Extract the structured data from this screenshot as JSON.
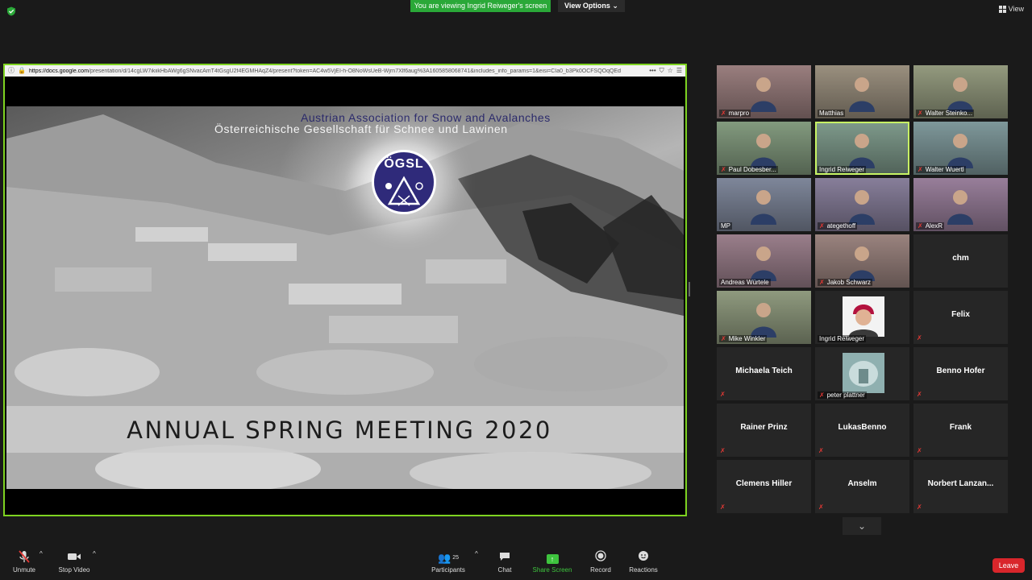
{
  "banner": {
    "viewing_text": "You are viewing Ingrid Reiweger's screen",
    "view_options_label": "View Options ⌄"
  },
  "top_right": {
    "view_label": "View"
  },
  "browser": {
    "url_host": "https://docs.google.com",
    "url_path": "/presentation/d/14cgLW7ikiikHbAWg6gSNvacAmT4tGsgU2f4EGMHAqZ4/present?token=AC4w5VjEI-h-O8NoWsUeB-Wjrn7Xlf6aug%3A1605858068741&includes_info_params=1&eisi=CIa0_b3Pk0OCFSQOqQEd"
  },
  "slide": {
    "subtitle_en": "Austrian Association for Snow and Avalanches",
    "subtitle_de": "Österreichische Gesellschaft für Schnee und Lawinen",
    "logo_text": "ÖGSL",
    "logo_sub": "ÖGSL",
    "title": "ANNUAL SPRING MEETING 2020"
  },
  "participants_gallery": [
    {
      "name": "marpro",
      "video": true,
      "muted": true
    },
    {
      "name": "Matthias",
      "video": true,
      "muted": false
    },
    {
      "name": "Walter Steinko...",
      "video": true,
      "muted": true
    },
    {
      "name": "Paul Dobesber...",
      "video": true,
      "muted": true
    },
    {
      "name": "Ingrid Reiweger",
      "video": true,
      "muted": false,
      "active": true
    },
    {
      "name": "Walter Wuertl",
      "video": true,
      "muted": true
    },
    {
      "name": "MP",
      "video": true,
      "muted": false
    },
    {
      "name": "ategethoff",
      "video": true,
      "muted": true
    },
    {
      "name": "AlexR",
      "video": true,
      "muted": true
    },
    {
      "name": "Andreas Würtele",
      "video": true,
      "muted": false
    },
    {
      "name": "Jakob Schwarz",
      "video": true,
      "muted": true
    },
    {
      "name": "chm",
      "video": false,
      "muted": false
    },
    {
      "name": "Mike Winkler",
      "video": true,
      "muted": true
    },
    {
      "name": "Ingrid Reiweger",
      "video": false,
      "picture": true,
      "muted": false
    },
    {
      "name": "Felix",
      "video": false,
      "muted": true
    },
    {
      "name": "Michaela Teich",
      "video": false,
      "muted": true
    },
    {
      "name": "peter plattner",
      "video": false,
      "picture": true,
      "muted": true
    },
    {
      "name": "Benno Hofer",
      "video": false,
      "muted": true
    },
    {
      "name": "Rainer Prinz",
      "video": false,
      "muted": true
    },
    {
      "name": "LukasBenno",
      "video": false,
      "muted": true
    },
    {
      "name": "Frank",
      "video": false,
      "muted": true
    },
    {
      "name": "Clemens Hiller",
      "video": false,
      "muted": true
    },
    {
      "name": "Anselm",
      "video": false,
      "muted": true
    },
    {
      "name": "Norbert  Lanzan...",
      "video": false,
      "muted": true
    }
  ],
  "toolbar": {
    "unmute": "Unmute",
    "stop_video": "Stop Video",
    "participants": "Participants",
    "participants_count": "25",
    "chat": "Chat",
    "share_screen": "Share Screen",
    "record": "Record",
    "reactions": "Reactions",
    "leave": "Leave"
  },
  "colors": {
    "accent_green": "#2aa838",
    "active_speaker": "#c7f464",
    "share_border": "#7ed321",
    "leave_red": "#d9262b"
  }
}
